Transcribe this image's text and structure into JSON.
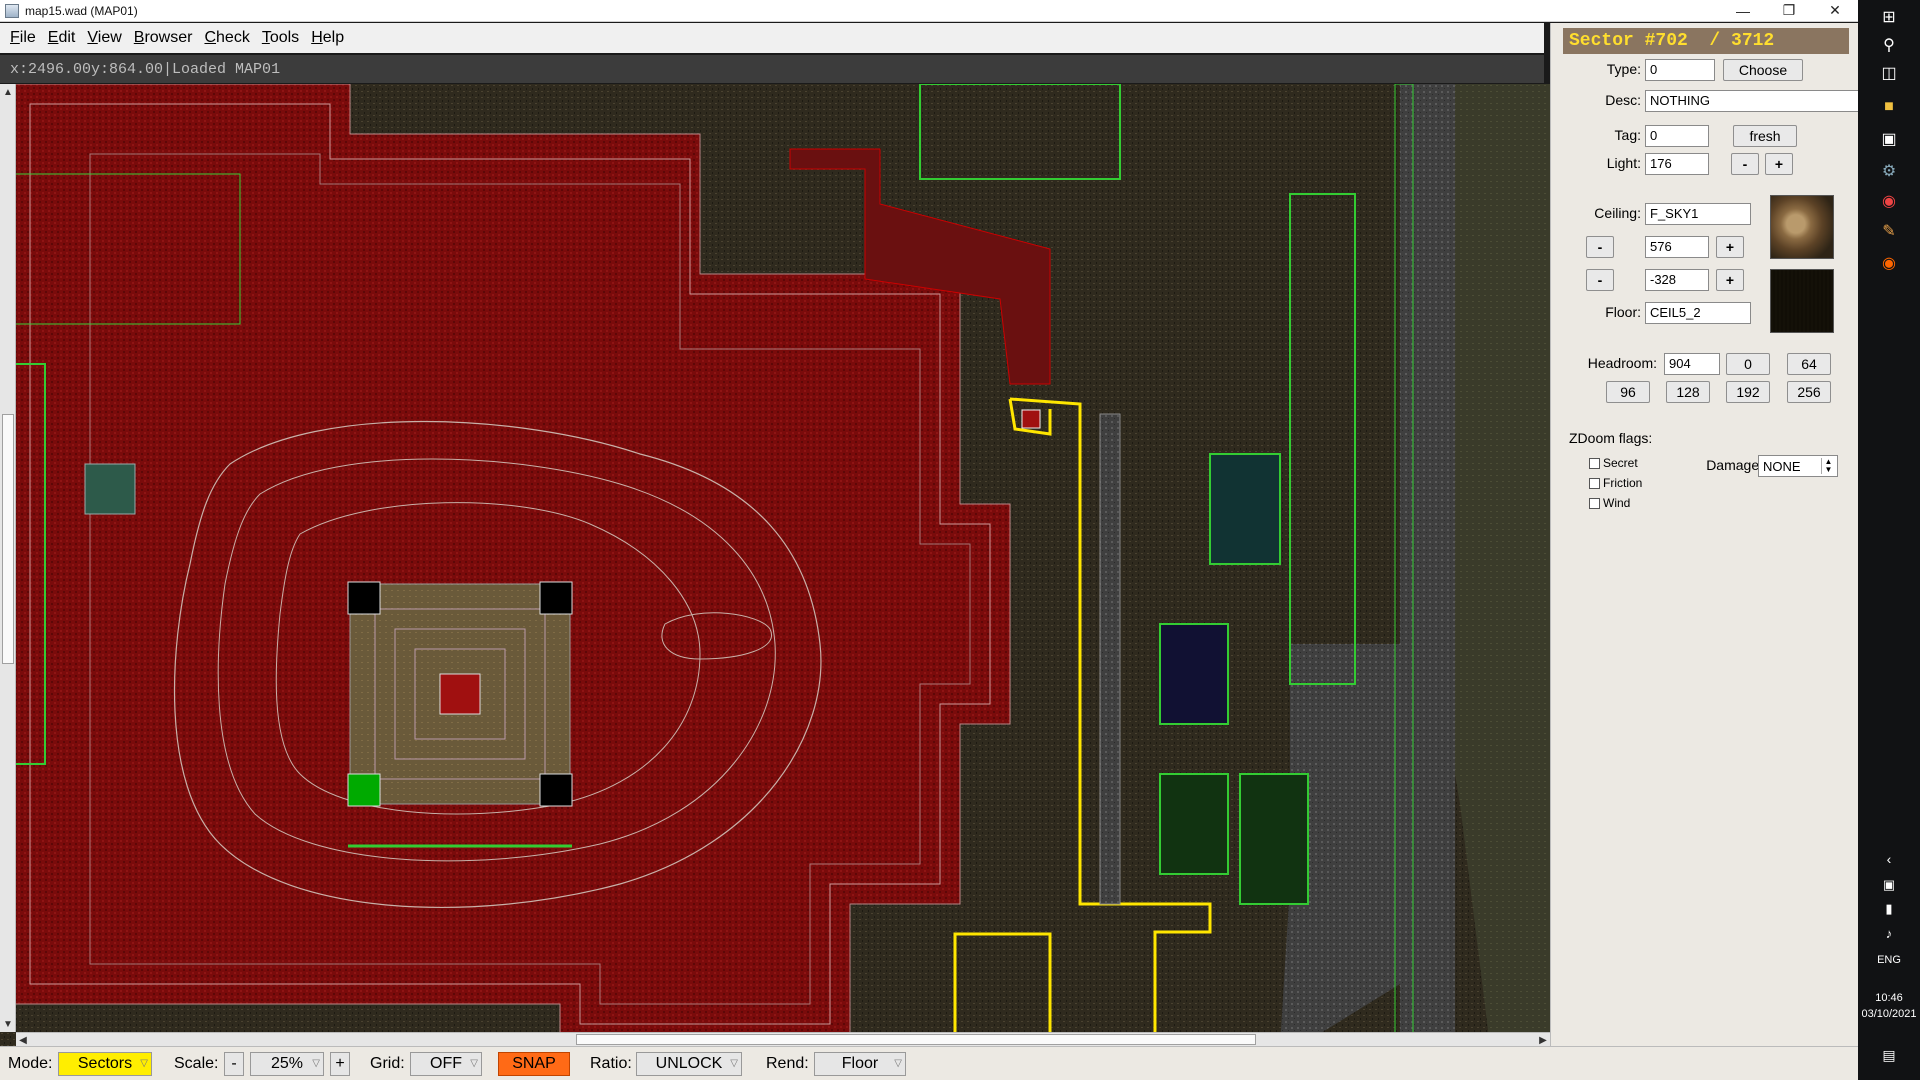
{
  "window": {
    "title": "map15.wad (MAP01)",
    "controls": [
      "minimize-icon",
      "restore-icon",
      "close-icon"
    ]
  },
  "menu": {
    "items": [
      {
        "label": "File",
        "underline": "F",
        "rest": "ile"
      },
      {
        "label": "Edit",
        "underline": "E",
        "rest": "dit"
      },
      {
        "label": "View",
        "underline": "V",
        "rest": "iew"
      },
      {
        "label": "Browser",
        "underline": "B",
        "rest": "rowser"
      },
      {
        "label": "Check",
        "underline": "C",
        "rest": "heck"
      },
      {
        "label": "Tools",
        "underline": "T",
        "rest": "ools"
      },
      {
        "label": "Help",
        "underline": "H",
        "rest": "elp"
      }
    ]
  },
  "status": {
    "coords_x": "x:2496.00",
    "coords_y": "y:864.00",
    "separator": "|",
    "message": "Loaded MAP01"
  },
  "panel": {
    "sector_title": "Sector #702  / 3712",
    "type_label": "Type:",
    "type_value": "0",
    "choose_label": "Choose",
    "desc_label": "Desc:",
    "desc_value": "NOTHING",
    "tag_label": "Tag:",
    "tag_value": "0",
    "fresh_label": "fresh",
    "light_label": "Light:",
    "light_value": "176",
    "minus": "-",
    "plus": "+",
    "ceiling_label": "Ceiling:",
    "ceiling_tex": "F_SKY1",
    "ceiling_height": "576",
    "floor_height": "-328",
    "floor_label": "Floor:",
    "floor_tex": "CEIL5_2",
    "headroom_label": "Headroom:",
    "headroom_value": "904",
    "headroom_presets": [
      "0",
      "64",
      "96",
      "128",
      "192",
      "256"
    ],
    "zdoom_label": "ZDoom flags:",
    "flags": [
      "Secret",
      "Friction",
      "Wind"
    ],
    "damage_label": "Damage:",
    "damage_value": "NONE"
  },
  "bottom": {
    "mode_label": "Mode:",
    "mode_value": "Sectors",
    "scale_label": "Scale:",
    "scale_minus": "-",
    "scale_value": "25%",
    "scale_plus": "+",
    "grid_label": "Grid:",
    "grid_value": "OFF",
    "snap_label": "SNAP",
    "ratio_label": "Ratio:",
    "ratio_value": "UNLOCK",
    "rend_label": "Rend:",
    "rend_value": "Floor"
  },
  "taskbar": {
    "lang": "ENG",
    "time": "10:46",
    "date": "03/10/2021"
  },
  "colors": {
    "sector_highlight": "#ffde2e",
    "map_red": "#7a0b0b",
    "map_green": "#35d62a",
    "mode_yellow": "#ffee00",
    "snap_orange": "#ff6a16"
  }
}
